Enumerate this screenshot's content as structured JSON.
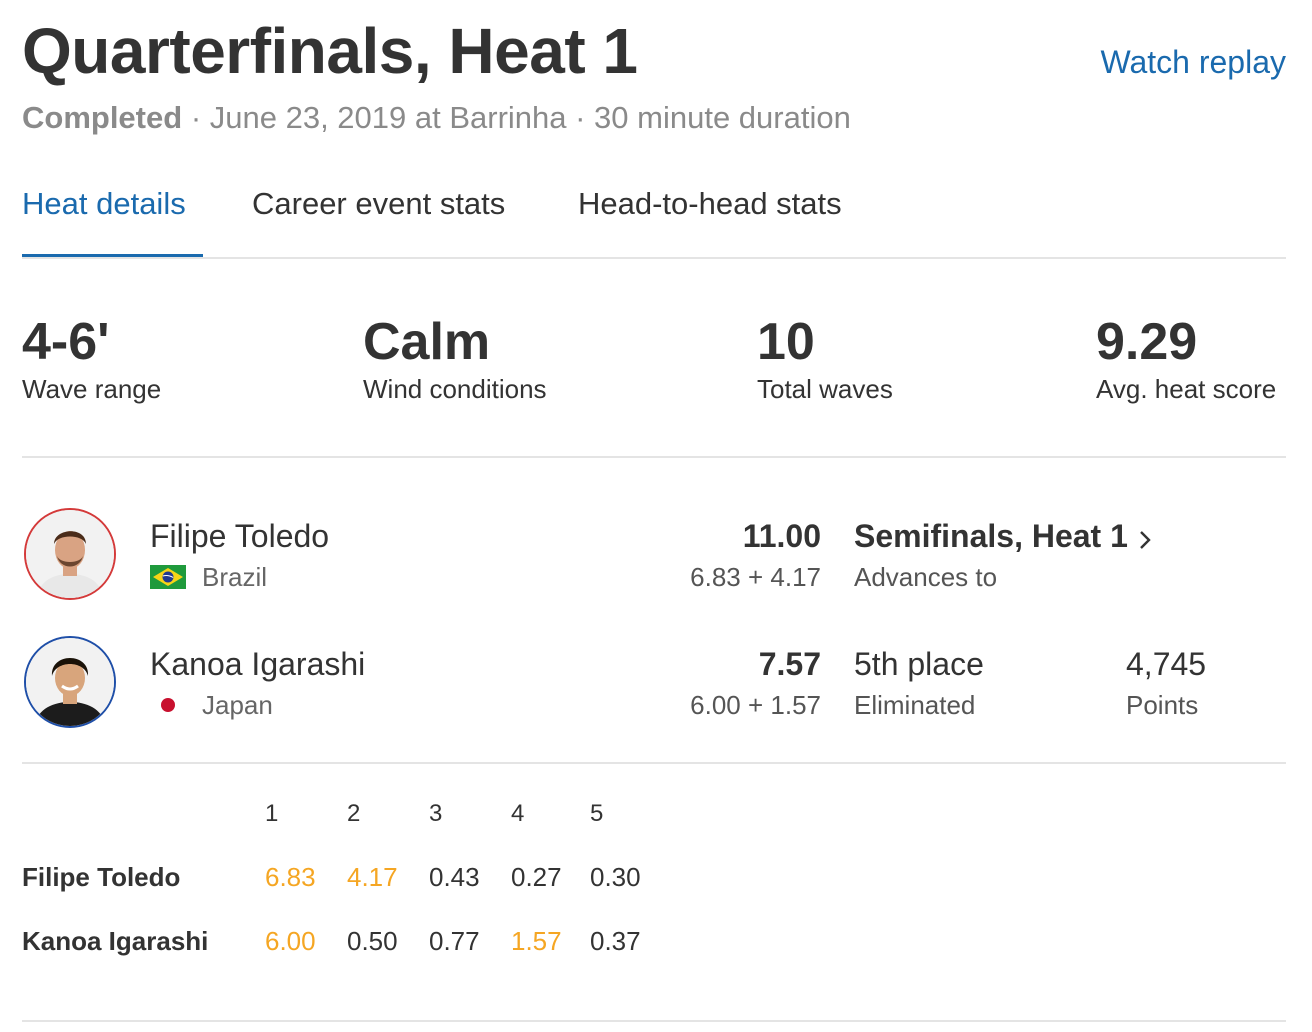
{
  "header": {
    "title": "Quarterfinals, Heat 1",
    "watch_replay": "Watch replay",
    "status": "Completed",
    "details": "· June 23, 2019 at Barrinha · 30 minute duration"
  },
  "tabs": [
    {
      "label": "Heat details",
      "active": true
    },
    {
      "label": "Career event stats",
      "active": false
    },
    {
      "label": "Head-to-head stats",
      "active": false
    }
  ],
  "stats": [
    {
      "value": "4-6'",
      "label": "Wave range"
    },
    {
      "value": "Calm",
      "label": "Wind conditions"
    },
    {
      "value": "10",
      "label": "Total waves"
    },
    {
      "value": "9.29",
      "label": "Avg. heat score"
    }
  ],
  "athletes": [
    {
      "name": "Filipe Toledo",
      "country": "Brazil",
      "flag_icon": "brazil-flag-icon",
      "ring_color": "#d43a3a",
      "total": "11.00",
      "breakdown": "6.83 + 4.17",
      "result": "Semifinals, Heat 1",
      "result_sub": "Advances to"
    },
    {
      "name": "Kanoa Igarashi",
      "country": "Japan",
      "flag_icon": "japan-flag-icon",
      "ring_color": "#1f4fa8",
      "total": "7.57",
      "breakdown": "6.00 + 1.57",
      "result": "5th place",
      "result_sub": "Eliminated",
      "points": "4,745",
      "points_label": "Points"
    }
  ],
  "wave_table": {
    "headers": [
      "1",
      "2",
      "3",
      "4",
      "5"
    ],
    "rows": [
      {
        "name": "Filipe Toledo",
        "scores": [
          "6.83",
          "4.17",
          "0.43",
          "0.27",
          "0.30"
        ],
        "highlighted": [
          0,
          1
        ]
      },
      {
        "name": "Kanoa Igarashi",
        "scores": [
          "6.00",
          "0.50",
          "0.77",
          "1.57",
          "0.37"
        ],
        "highlighted": [
          0,
          3
        ]
      }
    ],
    "highlight_color": "#f5a623"
  },
  "colors": {
    "accent": "#1a6aae",
    "text": "#333333",
    "muted": "#8a8a8a",
    "divider": "#e4e4e4"
  }
}
